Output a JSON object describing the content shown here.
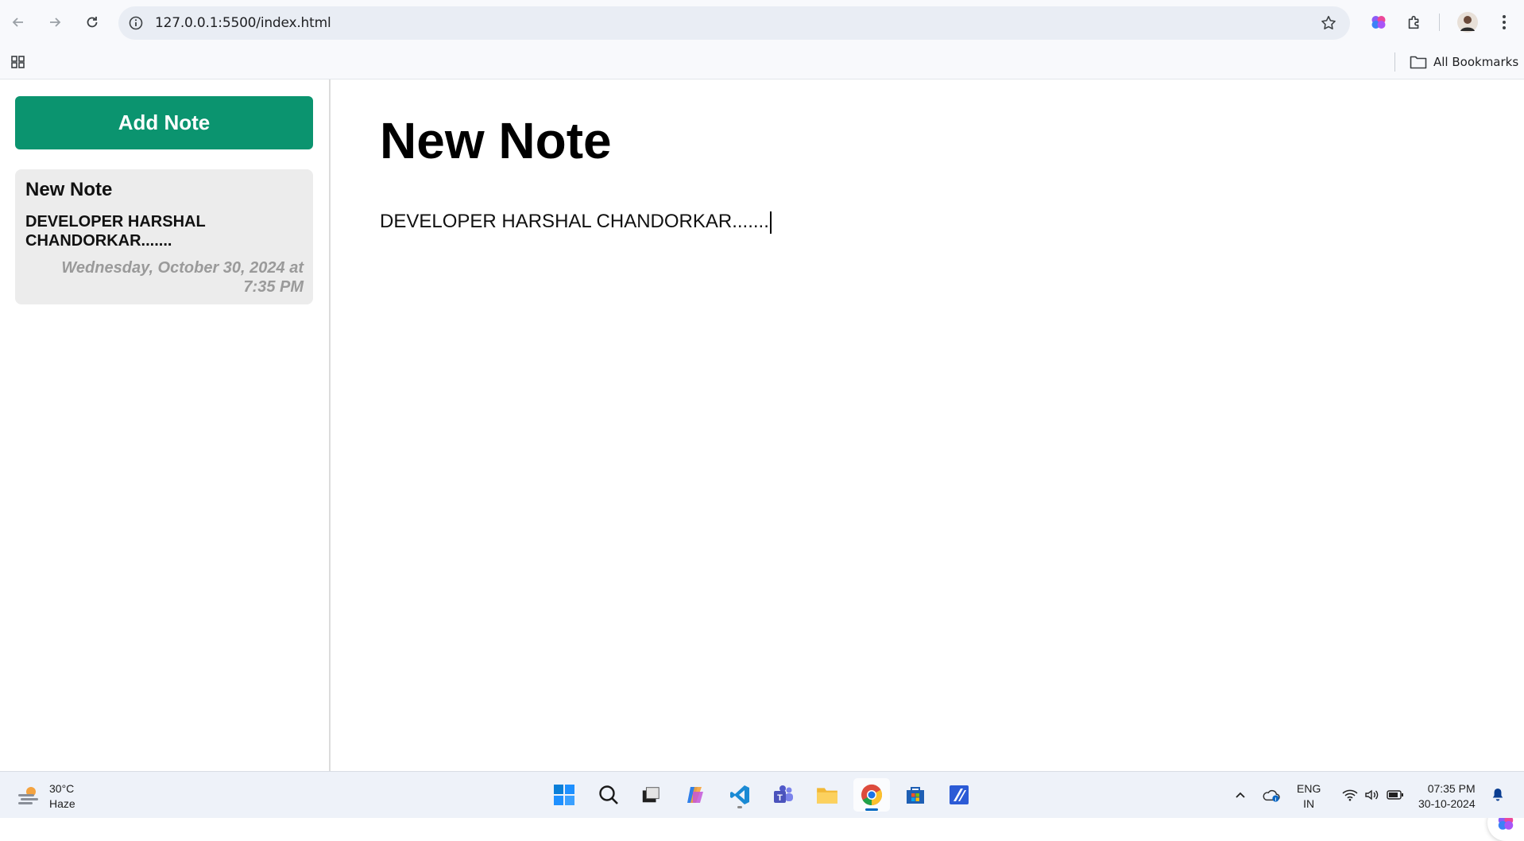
{
  "browser": {
    "url": "127.0.0.1:5500/index.html",
    "bookmarks_label": "All Bookmarks"
  },
  "sidebar": {
    "add_button_label": "Add Note",
    "notes": [
      {
        "title": "New Note",
        "body": "DEVELOPER HARSHAL CHANDORKAR.......",
        "date": "Wednesday, October 30, 2024 at 7:35 PM"
      }
    ]
  },
  "editor": {
    "title": "New Note",
    "body": "DEVELOPER HARSHAL CHANDORKAR......."
  },
  "taskbar": {
    "weather_temp": "30°C",
    "weather_desc": "Haze",
    "lang_top": "ENG",
    "lang_bottom": "IN",
    "time": "07:35 PM",
    "date": "30-10-2024"
  },
  "colors": {
    "accent": "#0b946f",
    "card_bg": "#ececec",
    "date_text": "#9a9a9a"
  }
}
